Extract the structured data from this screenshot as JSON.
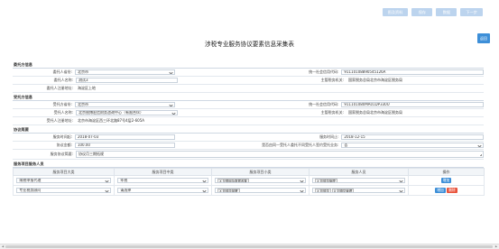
{
  "toolbar": {
    "buttons": [
      "图及资料",
      "保存",
      "数据",
      "下一步"
    ]
  },
  "page": {
    "title": "涉税专业服务协议要素信息采集表",
    "return_label": "返回"
  },
  "client": {
    "section": "委托方信息",
    "region_label": "委托人省份:",
    "region_value": "北京市",
    "name_label": "委托人名称:",
    "name_value": "测试3",
    "address_label": "委托人注册地址:",
    "address_value": "海淀区上地",
    "credit_label": "统一社会信用代码:",
    "credit_value": "911101088905451​26A",
    "tax_office_label": "主管税务机关:",
    "tax_office_value": "国家税务总局北京市海淀区税务局"
  },
  "agent": {
    "section": "受托方信息",
    "region_label": "受托方省份:",
    "region_value": "北京市",
    "name_label": "受托人名称:",
    "name_value": "北京税博宏信财务咨询中心（有限合伙）",
    "address_label": "受托人注册地址:",
    "address_value": "北京市海淀区西三环北路87号4层2-605A",
    "credit_label": "统一社会信用代码:",
    "credit_value": "911101080MA01DP330U",
    "tax_office_label": "主管税务机关:",
    "tax_office_value": "国家税务总局北京市海淀区税务局"
  },
  "agreement": {
    "section": "协议简要",
    "start_label": "服务时间起:",
    "start_value": "2018-07-03",
    "end_label": "服务时间止:",
    "end_value": "2018-12-15",
    "amount_label": "协议金额:",
    "amount_value": "100.00",
    "same_label": "是否由同一受托人委托不同受托人签约受托业务:",
    "same_value": "否",
    "summary_label": "服务协议简要:",
    "summary_value": "协议月三期拓规"
  },
  "staff": {
    "section": "服务项目服务人员",
    "headers": [
      "服务项目大类",
      "服务项目中类",
      "服务项目小类",
      "服务人员",
      "操作"
    ],
    "rows": [
      {
        "major": "纳税申报代理",
        "middle": "年税",
        "minor_tags": [
          "X 互联网及数据收集"
        ],
        "staff_tags": [
          "X 刘德华管理"
        ],
        "actions": [
          "增加"
        ]
      },
      {
        "major": "专业税务顾问",
        "middle": "请选择",
        "minor_tags": [
          "X 刘德华部署"
        ],
        "staff_tags": [
          "X 刘德华",
          "X 刘德华管理"
        ],
        "actions": [
          "增加",
          "删除"
        ]
      }
    ]
  }
}
